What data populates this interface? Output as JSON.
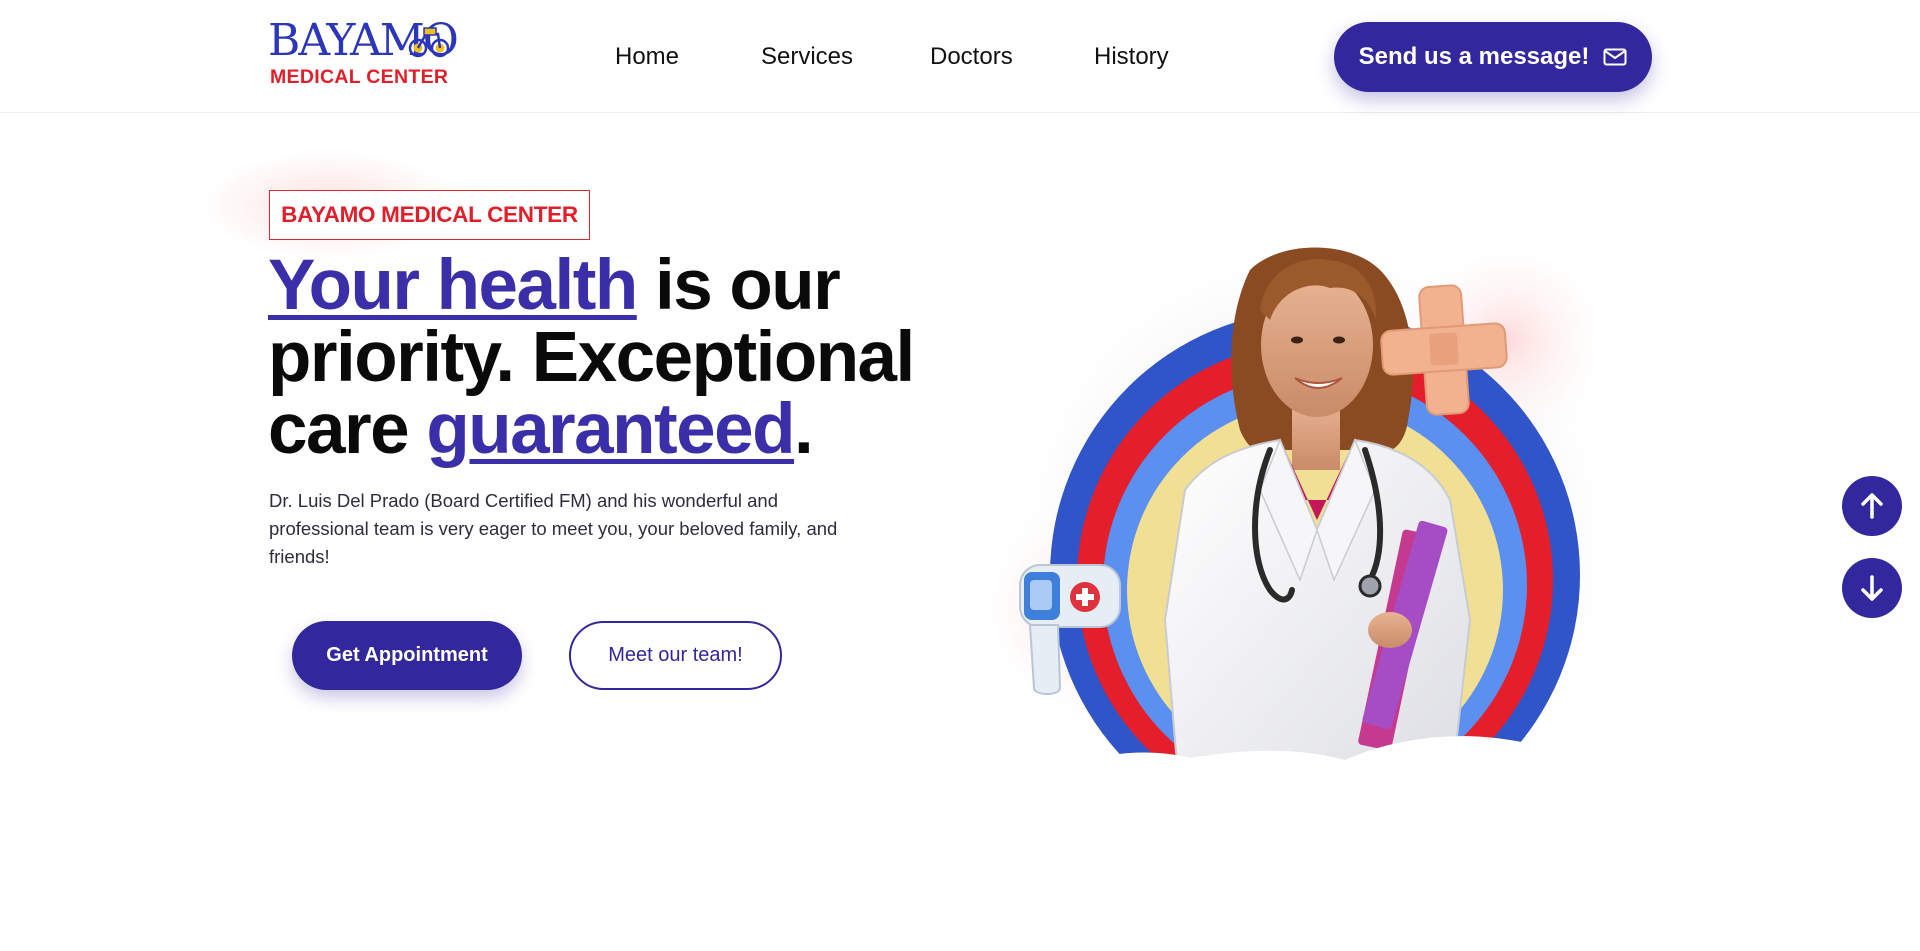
{
  "header": {
    "logo": {
      "top_text": "BAYAMO",
      "bottom_text": "MEDICAL CENTER"
    },
    "nav": [
      {
        "label": "Home"
      },
      {
        "label": "Services"
      },
      {
        "label": "Doctors"
      },
      {
        "label": "History"
      }
    ],
    "message_button": {
      "label": "Send us a message!",
      "icon": "envelope-icon"
    }
  },
  "hero": {
    "tag": "BAYAMO MEDICAL CENTER",
    "headline": {
      "part1_highlight": "Your health",
      "part2": " is our priority. Exceptional care ",
      "part3_highlight": "guaranteed",
      "part4": "."
    },
    "description": "Dr. Luis Del Prado (Board Certified FM) and his wonderful and professional team is very eager to meet you, your beloved family, and friends!",
    "primary_button": "Get Appointment",
    "secondary_button": "Meet our team!",
    "image": "doctor-illustration"
  },
  "scroll_controls": {
    "up_icon": "arrow-up-icon",
    "down_icon": "arrow-down-icon"
  },
  "colors": {
    "primary": "#33279d",
    "accent_red": "#e01f2a",
    "ring_blue": "#2f55c8",
    "ring_light_blue": "#5b8ff0",
    "ring_yellow": "#f1df93"
  }
}
